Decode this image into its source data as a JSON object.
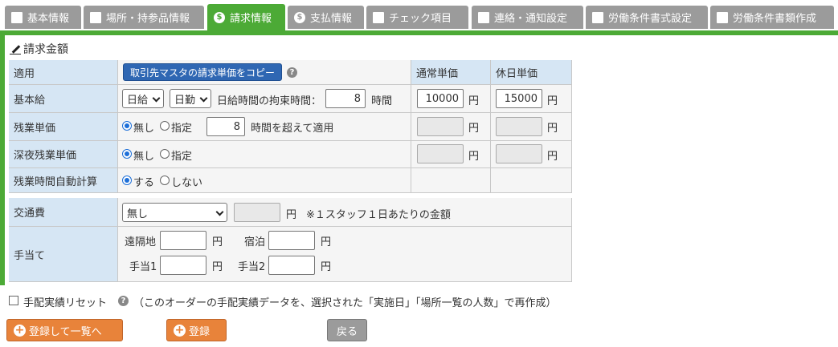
{
  "tabs": [
    {
      "label": "基本情報",
      "icon": "edit-icon"
    },
    {
      "label": "場所・持参品情報",
      "icon": "edit-icon"
    },
    {
      "label": "請求情報",
      "icon": "dollar-icon"
    },
    {
      "label": "支払情報",
      "icon": "dollar-icon"
    },
    {
      "label": "チェック項目",
      "icon": "edit-icon"
    },
    {
      "label": "連絡・通知設定",
      "icon": "edit-icon"
    },
    {
      "label": "労働条件書式設定",
      "icon": "edit-icon"
    },
    {
      "label": "労働条件書類作成",
      "icon": "edit-icon"
    }
  ],
  "section_title": "請求金額",
  "billing": {
    "apply_label": "適用",
    "copy_button": "取引先マスタの請求単価をコピー",
    "normal_price_header": "通常単価",
    "holiday_price_header": "休日単価",
    "base_pay_label": "基本給",
    "pay_unit": "日給",
    "pay_mode": "日勤",
    "bound_hours_label": "日給時間の拘束時間：",
    "bound_hours": "8",
    "hours_unit": "時間",
    "normal_base": "10000",
    "holiday_base": "15000",
    "yen": "円",
    "overtime_label": "残業単価",
    "none_label": "無し",
    "specify_label": "指定",
    "overtime_threshold": "8",
    "overtime_threshold_suffix": "時間を超えて適用",
    "night_label": "深夜残業単価",
    "auto_calc_label": "残業時間自動計算",
    "do_label": "する",
    "dont_label": "しない"
  },
  "extra": {
    "transport_label": "交通費",
    "transport_option": "無し",
    "transport_amount": "",
    "transport_note": "※１スタッフ１日あたりの金額",
    "allowance_label": "手当て",
    "remote_label": "遠隔地",
    "lodging_label": "宿泊",
    "allow1_label": "手当1",
    "allow2_label": "手当2",
    "remote_value": "",
    "lodging_value": "",
    "allow1_value": "",
    "allow2_value": ""
  },
  "reset": {
    "label": "手配実績リセット",
    "note": "（このオーダーの手配実績データを、選択された「実施日」「場所一覧の人数」で再作成）"
  },
  "buttons": {
    "register_list": "登録して一覧へ",
    "register": "登録",
    "back": "戻る"
  }
}
